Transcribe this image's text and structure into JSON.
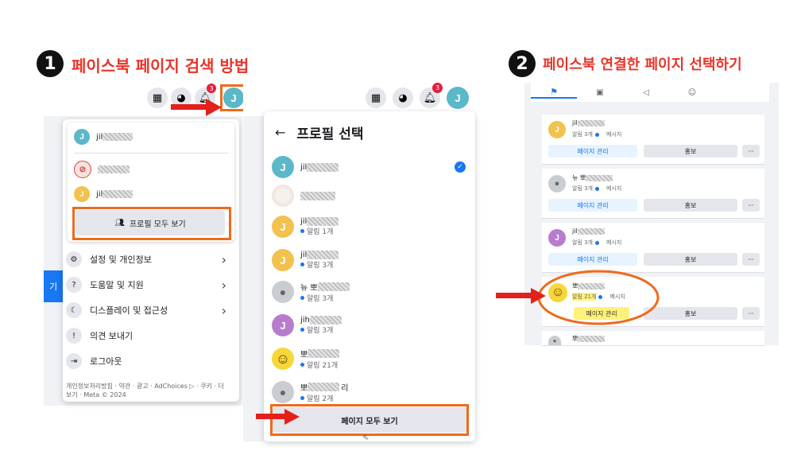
{
  "step1": {
    "number": "1",
    "title": "페이스북 페이지 검색 방법"
  },
  "step2": {
    "number": "2",
    "title": "페이스북 연결한 페이지 선택하기"
  },
  "left_panel": {
    "notif_count": "3",
    "avatar_letter": "J",
    "account_name": "jil",
    "shortcut1_name": "",
    "shortcut2_name": "jil",
    "view_all_profiles": "프로필 모두 보기",
    "side_button": "기",
    "menu": [
      {
        "label": "설정 및 개인정보",
        "icon": "gear-icon"
      },
      {
        "label": "도움말 및 지원",
        "icon": "help-icon"
      },
      {
        "label": "디스플레이 및 접근성",
        "icon": "moon-icon"
      },
      {
        "label": "의견 보내기",
        "icon": "feedback-icon"
      },
      {
        "label": "로그아웃",
        "icon": "logout-icon"
      }
    ],
    "footer_line1": "개인정보처리방침 · 약관 · 광고 · AdChoices ▷ · 쿠키 · 더",
    "footer_line2": "보기 · Meta © 2024"
  },
  "middle_panel": {
    "notif_count": "3",
    "avatar_letter": "J",
    "back_arrow": "←",
    "title": "프로필 선택",
    "profiles": [
      {
        "letter": "J",
        "color": "teal",
        "name": "jil",
        "notice": "",
        "selected": true
      },
      {
        "letter": "",
        "color": "photo",
        "name": "",
        "notice": ""
      },
      {
        "letter": "J",
        "color": "yellow",
        "name": "jil",
        "notice": "알림 1개"
      },
      {
        "letter": "J",
        "color": "yellow",
        "name": "jil",
        "notice": "알림 3개"
      },
      {
        "letter": "",
        "color": "gray",
        "name": "뉴 뽀",
        "notice": "알림 3개"
      },
      {
        "letter": "J",
        "color": "purple",
        "name": "jih",
        "notice": "알림 3개"
      },
      {
        "letter": "",
        "color": "smiley",
        "name": "뽀",
        "notice": "알림 21개"
      },
      {
        "letter": "",
        "color": "gray",
        "name": "뽀",
        "suffix": "리",
        "notice": "알림 2개"
      }
    ],
    "view_all_pages": "페이지 모두 보기"
  },
  "right_panel": {
    "cards": [
      {
        "avatar": "yellow",
        "letter": "J",
        "name": "jil",
        "notice": "알림 3개",
        "message": "메시지",
        "manage": "페이지 관리",
        "promote": "홍보",
        "more": "···"
      },
      {
        "avatar": "gray",
        "letter": "",
        "name": "뉴 뽀",
        "notice": "알림 3개",
        "message": "메시지",
        "manage": "페이지 관리",
        "promote": "홍보",
        "more": "···"
      },
      {
        "avatar": "purple",
        "letter": "J",
        "name": "jil",
        "notice": "알림 3개",
        "message": "메시지",
        "manage": "페이지 관리",
        "promote": "홍보",
        "more": "···"
      },
      {
        "avatar": "smiley",
        "letter": "",
        "name": "뽀",
        "notice": "알림 21개",
        "message": "메시지",
        "manage": "페이지 관리",
        "promote": "홍보",
        "more": "···"
      },
      {
        "avatar": "gray",
        "letter": "",
        "name": "뽀",
        "notice": "",
        "message": "",
        "manage": "",
        "promote": "",
        "more": ""
      }
    ]
  },
  "colors": {
    "accent_red": "#e8352a",
    "highlight_orange": "#f06a1a",
    "facebook_blue": "#1877f2"
  }
}
